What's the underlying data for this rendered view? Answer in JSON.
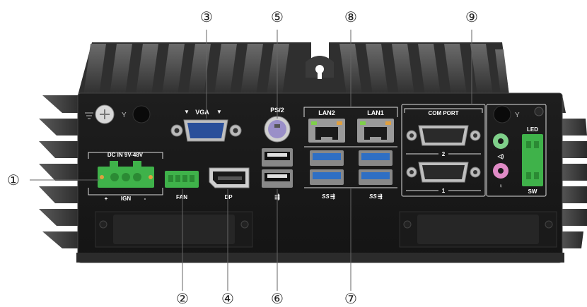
{
  "callouts": {
    "c1": "①",
    "c2": "②",
    "c3": "③",
    "c4": "④",
    "c5": "⑤",
    "c6": "⑥",
    "c7": "⑦",
    "c8": "⑧",
    "c9": "⑨"
  },
  "labels": {
    "vga": "VGA",
    "ps2": "PS/2",
    "lan2": "LAN2",
    "lan1": "LAN1",
    "com_port": "COM PORT",
    "com2": "2",
    "com1": "1",
    "led": "LED",
    "sw": "SW",
    "dc_in": "DC IN 9V-48V",
    "plus": "+",
    "ign": "IGN",
    "minus": "-",
    "fan": "FAN",
    "dp": "DP",
    "usb_ss_a": "SS",
    "usb_ss_b": "SS"
  },
  "colors": {
    "chassis": "#1c1c1c",
    "fins": "#3a3a3a",
    "terminal_green": "#3fb24a",
    "audio_green": "#7fd08a",
    "audio_pink": "#e08bc6",
    "usb3_blue": "#2f6fc4",
    "ps2_purple": "#9a8fc8",
    "vga_blue": "#2a4f9a"
  }
}
